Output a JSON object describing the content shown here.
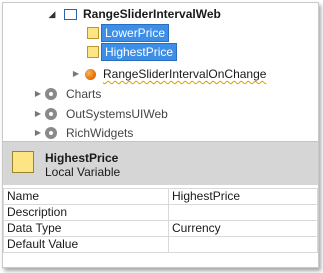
{
  "tree": {
    "web_block": "RangeSliderIntervalWeb",
    "var_lower": "LowerPrice",
    "var_highest": "HighestPrice",
    "action": "RangeSliderIntervalOnChange",
    "modules": [
      "Charts",
      "OutSystemsUIWeb",
      "RichWidgets"
    ]
  },
  "header": {
    "title": "HighestPrice",
    "subtitle": "Local Variable"
  },
  "properties": [
    {
      "name": "Name",
      "value": "HighestPrice"
    },
    {
      "name": "Description",
      "value": ""
    },
    {
      "name": "Data Type",
      "value": "Currency"
    },
    {
      "name": "Default Value",
      "value": ""
    }
  ],
  "colors": {
    "selection": "#3c8ee6",
    "variable_icon": "#fde585",
    "header_bg": "#d6d6d6"
  }
}
